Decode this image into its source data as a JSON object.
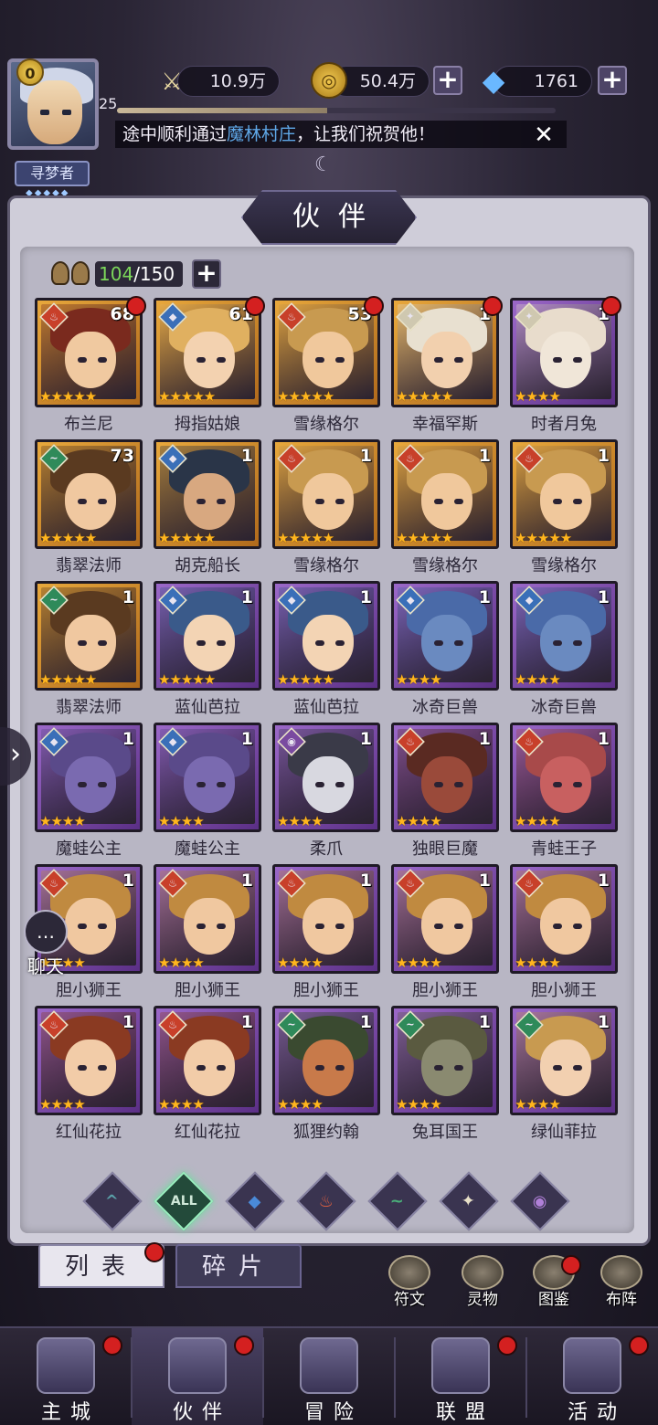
{
  "player": {
    "vip": "0",
    "level": "25",
    "title_badge": "寻梦者",
    "xp_fraction": 0.48
  },
  "resources": [
    {
      "name": "power",
      "icon": "sword-icon",
      "value": "10.9万"
    },
    {
      "name": "gold",
      "icon": "gold-coin-icon",
      "value": "50.4万"
    },
    {
      "name": "diamond",
      "icon": "diamond-icon",
      "value": "1761"
    }
  ],
  "ticker": {
    "prefix": "途中顺利通过",
    "highlight": "魔林村庄",
    "suffix": "，让我们祝贺他！"
  },
  "panel_title": "伙伴",
  "partner_count": {
    "current": "104",
    "max": "/150"
  },
  "element_colors": {
    "fire": "#c8402a",
    "water": "#3a6fb8",
    "wind": "#2f8a5a",
    "light": "#cfc8b0",
    "dark": "#7a4aa0"
  },
  "cards": [
    {
      "name": "布兰尼",
      "level": "68",
      "element": "fire",
      "frame": "gold",
      "stars": "★★★★★",
      "dot": true,
      "hair": "#7a2a1e",
      "skin": "#f0c9a0"
    },
    {
      "name": "拇指姑娘",
      "level": "61",
      "element": "water",
      "frame": "gold",
      "stars": "★★★★★",
      "dot": true,
      "hair": "#e0b060",
      "skin": "#f3d2b0"
    },
    {
      "name": "雪缘格尔",
      "level": "53",
      "element": "fire",
      "frame": "gold",
      "stars": "★★★★★",
      "dot": true,
      "hair": "#c89a50",
      "skin": "#f0c89c"
    },
    {
      "name": "幸福罕斯",
      "level": "1",
      "element": "light",
      "frame": "gold",
      "stars": "★★★★★",
      "dot": true,
      "hair": "#e8e0d0",
      "skin": "#f2d0ae"
    },
    {
      "name": "时者月兔",
      "level": "1",
      "element": "light",
      "frame": "purple",
      "stars": "★★★★",
      "dot": true,
      "hair": "#e8dccc",
      "skin": "#f0e6d8"
    },
    {
      "name": "翡翠法师",
      "level": "73",
      "element": "wind",
      "frame": "gold",
      "stars": "★★★★★",
      "dot": false,
      "hair": "#5a3a20",
      "skin": "#f0c8a0"
    },
    {
      "name": "胡克船长",
      "level": "1",
      "element": "water",
      "frame": "gold",
      "stars": "★★★★★",
      "dot": false,
      "hair": "#2a3548",
      "skin": "#d8a880"
    },
    {
      "name": "雪缘格尔",
      "level": "1",
      "element": "fire",
      "frame": "gold",
      "stars": "★★★★★",
      "dot": false,
      "hair": "#c89a50",
      "skin": "#f0c89c"
    },
    {
      "name": "雪缘格尔",
      "level": "1",
      "element": "fire",
      "frame": "gold",
      "stars": "★★★★★",
      "dot": false,
      "hair": "#c89a50",
      "skin": "#f0c89c"
    },
    {
      "name": "雪缘格尔",
      "level": "1",
      "element": "fire",
      "frame": "gold",
      "stars": "★★★★★",
      "dot": false,
      "hair": "#c89a50",
      "skin": "#f0c89c"
    },
    {
      "name": "翡翠法师",
      "level": "1",
      "element": "wind",
      "frame": "gold",
      "stars": "★★★★★",
      "dot": false,
      "hair": "#5a3a20",
      "skin": "#f0c8a0"
    },
    {
      "name": "蓝仙芭拉",
      "level": "1",
      "element": "water",
      "frame": "purple",
      "stars": "★★★★★",
      "dot": false,
      "hair": "#3a5a8a",
      "skin": "#f3d4b4"
    },
    {
      "name": "蓝仙芭拉",
      "level": "1",
      "element": "water",
      "frame": "purple",
      "stars": "★★★★★",
      "dot": false,
      "hair": "#3a5a8a",
      "skin": "#f3d4b4"
    },
    {
      "name": "冰奇巨兽",
      "level": "1",
      "element": "water",
      "frame": "purple",
      "stars": "★★★★",
      "dot": false,
      "hair": "#4a6aa8",
      "skin": "#6a8ac0"
    },
    {
      "name": "冰奇巨兽",
      "level": "1",
      "element": "water",
      "frame": "purple",
      "stars": "★★★★",
      "dot": false,
      "hair": "#4a6aa8",
      "skin": "#6a8ac0"
    },
    {
      "name": "魔蛙公主",
      "level": "1",
      "element": "water",
      "frame": "purple",
      "stars": "★★★★",
      "dot": false,
      "hair": "#5a4a8a",
      "skin": "#7a6ab0"
    },
    {
      "name": "魔蛙公主",
      "level": "1",
      "element": "water",
      "frame": "purple",
      "stars": "★★★★",
      "dot": false,
      "hair": "#5a4a8a",
      "skin": "#7a6ab0"
    },
    {
      "name": "柔爪",
      "level": "1",
      "element": "dark",
      "frame": "purple",
      "stars": "★★★★",
      "dot": false,
      "hair": "#3a3a48",
      "skin": "#d8d8e0"
    },
    {
      "name": "独眼巨魔",
      "level": "1",
      "element": "fire",
      "frame": "purple",
      "stars": "★★★★",
      "dot": false,
      "hair": "#5a2a22",
      "skin": "#9a4a3a"
    },
    {
      "name": "青蛙王子",
      "level": "1",
      "element": "fire",
      "frame": "purple",
      "stars": "★★★★",
      "dot": false,
      "hair": "#a84a4a",
      "skin": "#c86060"
    },
    {
      "name": "胆小狮王",
      "level": "1",
      "element": "fire",
      "frame": "purple",
      "stars": "★★★★",
      "dot": false,
      "hair": "#c08a40",
      "skin": "#f0c8a0"
    },
    {
      "name": "胆小狮王",
      "level": "1",
      "element": "fire",
      "frame": "purple",
      "stars": "★★★★",
      "dot": false,
      "hair": "#c08a40",
      "skin": "#f0c8a0"
    },
    {
      "name": "胆小狮王",
      "level": "1",
      "element": "fire",
      "frame": "purple",
      "stars": "★★★★",
      "dot": false,
      "hair": "#c08a40",
      "skin": "#f0c8a0"
    },
    {
      "name": "胆小狮王",
      "level": "1",
      "element": "fire",
      "frame": "purple",
      "stars": "★★★★",
      "dot": false,
      "hair": "#c08a40",
      "skin": "#f0c8a0"
    },
    {
      "name": "胆小狮王",
      "level": "1",
      "element": "fire",
      "frame": "purple",
      "stars": "★★★★",
      "dot": false,
      "hair": "#c08a40",
      "skin": "#f0c8a0"
    },
    {
      "name": "红仙花拉",
      "level": "1",
      "element": "fire",
      "frame": "purple",
      "stars": "★★★★",
      "dot": false,
      "hair": "#8a3a22",
      "skin": "#f2cca8"
    },
    {
      "name": "红仙花拉",
      "level": "1",
      "element": "fire",
      "frame": "purple",
      "stars": "★★★★",
      "dot": false,
      "hair": "#8a3a22",
      "skin": "#f2cca8"
    },
    {
      "name": "狐狸约翰",
      "level": "1",
      "element": "wind",
      "frame": "purple",
      "stars": "★★★★",
      "dot": false,
      "hair": "#3a4a30",
      "skin": "#c87a4a"
    },
    {
      "name": "兔耳国王",
      "level": "1",
      "element": "wind",
      "frame": "purple",
      "stars": "★★★★",
      "dot": false,
      "hair": "#5a5a40",
      "skin": "#8a8a70"
    },
    {
      "name": "绿仙菲拉",
      "level": "1",
      "element": "wind",
      "frame": "purple",
      "stars": "★★★★",
      "dot": false,
      "hair": "#c89a50",
      "skin": "#f2d0b0"
    }
  ],
  "element_filters": [
    {
      "id": "wind2",
      "glyph": "^",
      "color": "#5aa0a8"
    },
    {
      "id": "all",
      "glyph": "ALL",
      "color": "#cfe8d8"
    },
    {
      "id": "water",
      "glyph": "◆",
      "color": "#4a8ad8"
    },
    {
      "id": "fire",
      "glyph": "♨",
      "color": "#e06040"
    },
    {
      "id": "wind",
      "glyph": "~",
      "color": "#4ab07a"
    },
    {
      "id": "light",
      "glyph": "✦",
      "color": "#e8e0c8"
    },
    {
      "id": "dark",
      "glyph": "◉",
      "color": "#b080d8"
    }
  ],
  "tabs": {
    "list": "列表",
    "fragments": "碎片"
  },
  "side_tools": [
    {
      "label": "符文",
      "dot": false
    },
    {
      "label": "灵物",
      "dot": false
    },
    {
      "label": "图鉴",
      "dot": true
    },
    {
      "label": "布阵",
      "dot": false
    }
  ],
  "chat": {
    "label": "聊天",
    "glyph": "…"
  },
  "nav": [
    {
      "label": "主城",
      "dot": true,
      "active": false
    },
    {
      "label": "伙伴",
      "dot": true,
      "active": true
    },
    {
      "label": "冒险",
      "dot": false,
      "active": false
    },
    {
      "label": "联盟",
      "dot": true,
      "active": false
    },
    {
      "label": "活动",
      "dot": true,
      "active": false
    }
  ]
}
